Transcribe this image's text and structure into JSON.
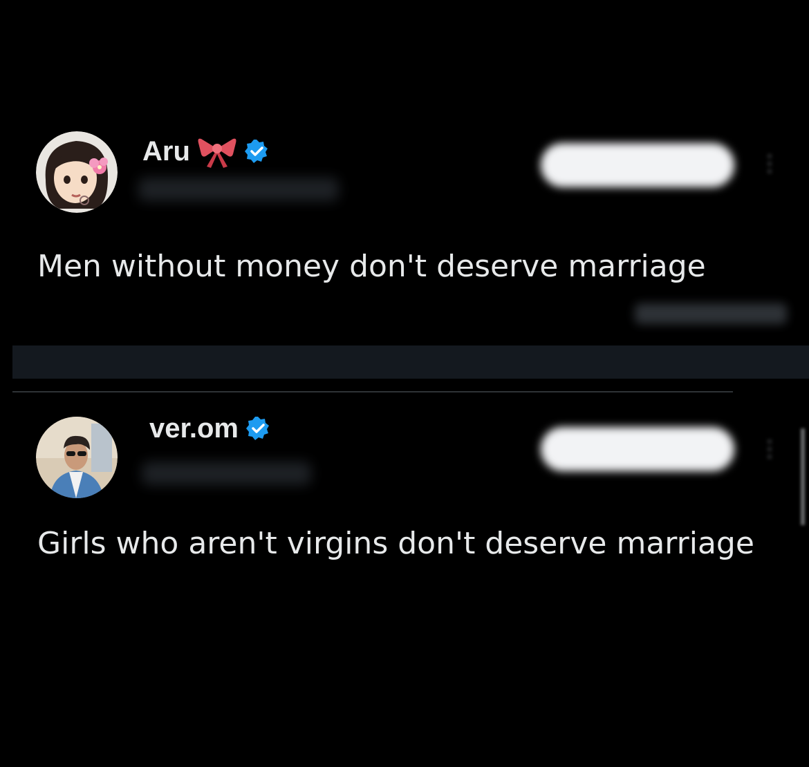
{
  "tweets": [
    {
      "display_name": "Aru",
      "badge_emoji": "bow-icon",
      "verified": true,
      "text": "Men without money don't deserve marriage",
      "avatar": "cartoon-girl-avatar"
    },
    {
      "display_name": "ver.om",
      "verified": true,
      "text": "Girls who aren't virgins don't deserve marriage",
      "avatar": "man-photo-avatar"
    }
  ],
  "colors": {
    "background": "#000000",
    "text": "#e7e9ea",
    "verified_blue": "#1d9bf0",
    "divider": "#2f3336"
  }
}
